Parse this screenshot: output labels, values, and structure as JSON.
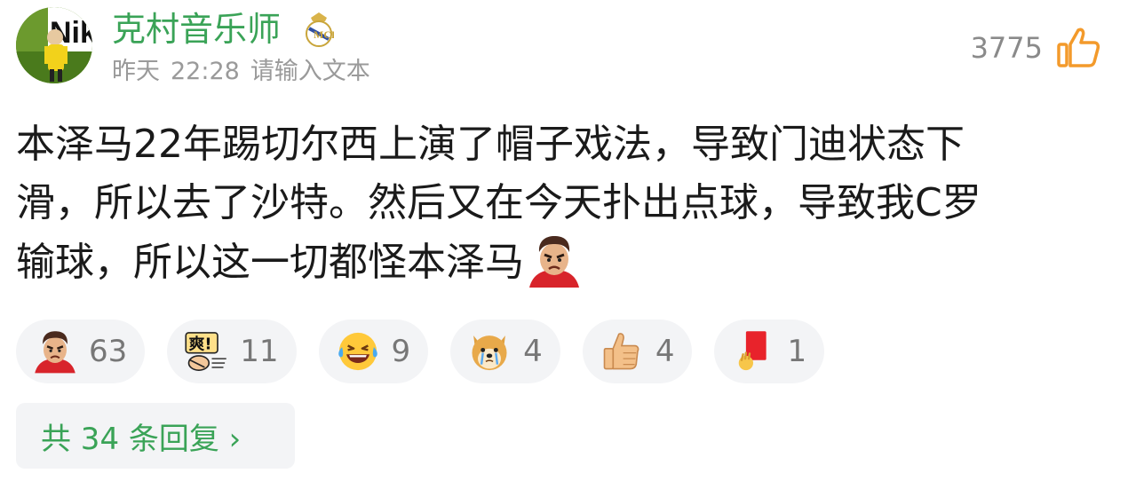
{
  "user": {
    "name": "克村音乐师",
    "date": "昨天",
    "time": "22:28",
    "location": "请输入文本",
    "avatar_text": "Nik"
  },
  "likes": {
    "count": "3775"
  },
  "post": {
    "line1": "本泽马22年踢切尔西上演了帽子戏法，导致门迪状态下",
    "line2": "滑，所以去了沙特。然后又在今天扑出点球，导致我C罗",
    "line3": "输球，所以这一切都怪本泽马"
  },
  "reactions": [
    {
      "icon": "angry-man-emoji-icon",
      "count": "63"
    },
    {
      "icon": "shuang-emoji-icon",
      "count": "11"
    },
    {
      "icon": "laughing-tears-emoji-icon",
      "count": "9"
    },
    {
      "icon": "crying-doge-emoji-icon",
      "count": "4"
    },
    {
      "icon": "thumbs-up-emoji-icon",
      "count": "4"
    },
    {
      "icon": "red-card-emoji-icon",
      "count": "1"
    }
  ],
  "replies": {
    "label": "共 34 条回复 ›"
  },
  "colors": {
    "accent_green": "#3aa357",
    "like_orange": "#f39a2b",
    "pill_bg": "#f3f4f6"
  }
}
